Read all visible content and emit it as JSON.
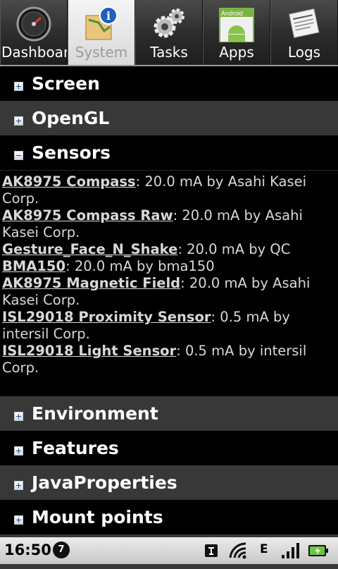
{
  "tabs": [
    {
      "label": "Dashboard",
      "icon": "dashboard-gauge-icon",
      "active": false
    },
    {
      "label": "System",
      "icon": "system-info-icon",
      "active": true
    },
    {
      "label": "Tasks",
      "icon": "gears-icon",
      "active": false
    },
    {
      "label": "Apps",
      "icon": "android-apps-icon",
      "active": false,
      "icon_text": "Android"
    },
    {
      "label": "Logs",
      "icon": "logs-paper-icon",
      "active": false
    }
  ],
  "groups_top": [
    {
      "title": "Screen",
      "expanded": false
    },
    {
      "title": "OpenGL",
      "expanded": false
    },
    {
      "title": "Sensors",
      "expanded": true
    }
  ],
  "sensors": [
    {
      "name": "AK8975 Compass",
      "detail": ": 20.0 mA by Asahi Kasei Corp."
    },
    {
      "name": "AK8975 Compass Raw",
      "detail": ": 20.0 mA by Asahi Kasei Corp."
    },
    {
      "name": "Gesture_Face_N_Shake",
      "detail": ": 20.0 mA by QC"
    },
    {
      "name": "BMA150",
      "detail": ": 20.0 mA by bma150"
    },
    {
      "name": "AK8975 Magnetic Field",
      "detail": ": 20.0 mA by Asahi Kasei Corp."
    },
    {
      "name": "ISL29018 Proximity Sensor",
      "detail": ": 0.5 mA by intersil Corp."
    },
    {
      "name": "ISL29018 Light Sensor",
      "detail": ": 0.5 mA by intersil Corp."
    }
  ],
  "groups_bottom": [
    {
      "title": "Environment",
      "expanded": false
    },
    {
      "title": "Features",
      "expanded": false
    },
    {
      "title": "JavaProperties",
      "expanded": false
    },
    {
      "title": "Mount points",
      "expanded": false
    },
    {
      "title": "",
      "expanded": false
    }
  ],
  "statusbar": {
    "time": "16:50",
    "notification_count": "7",
    "network_type": "E",
    "icons": [
      "usb-debug-icon",
      "wifi-icon",
      "signal-icon",
      "battery-charging-icon"
    ]
  }
}
